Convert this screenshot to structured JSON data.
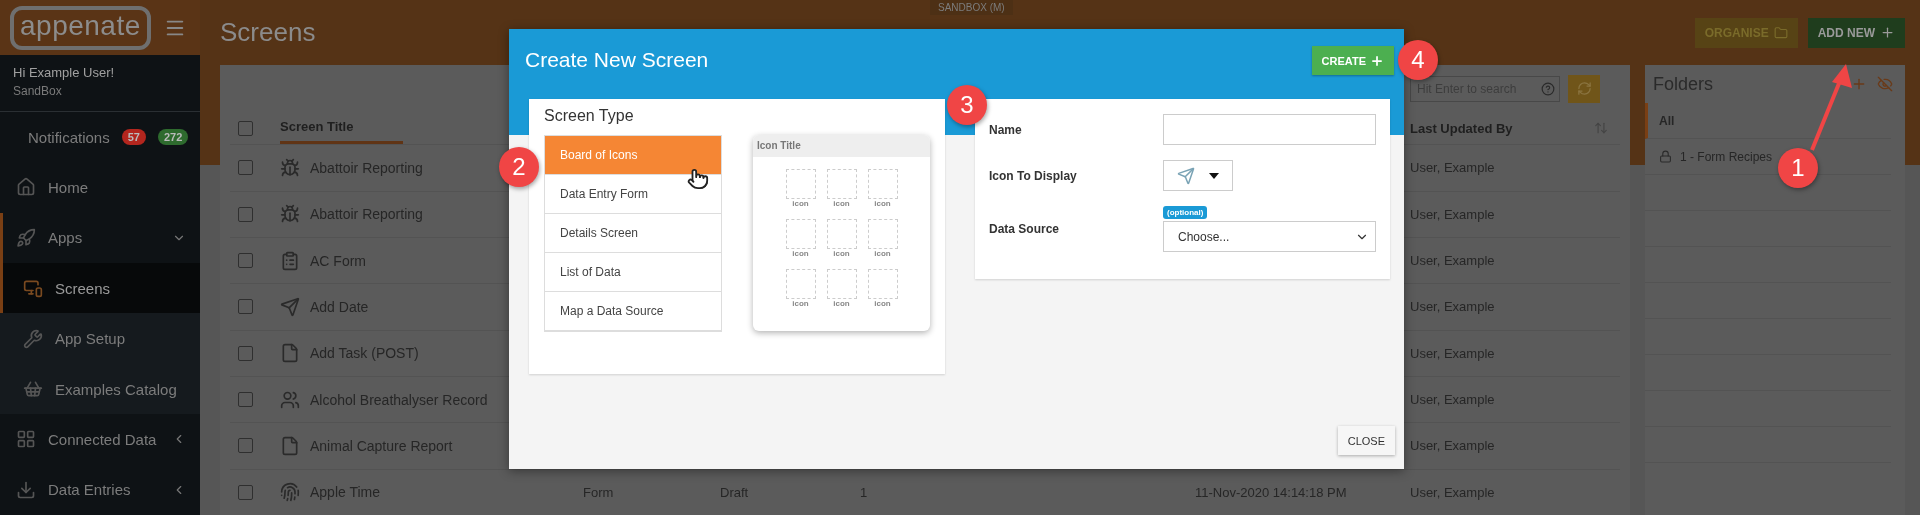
{
  "brand": {
    "name": "appenate"
  },
  "environment_badge": "SANDBOX (M)",
  "user": {
    "greeting": "Hi Example User!",
    "account": "SandBox"
  },
  "sidebar": {
    "items": [
      {
        "label": "Notifications",
        "selected": false,
        "badges": [
          {
            "text": "57",
            "color": "#b3261e"
          },
          {
            "text": "272",
            "color": "#2e6b2e"
          }
        ]
      },
      {
        "label": "Home",
        "selected": false
      },
      {
        "label": "Apps",
        "selected": false,
        "expanded": true,
        "children": [
          {
            "label": "Screens",
            "selected": true
          },
          {
            "label": "App Setup",
            "selected": false
          },
          {
            "label": "Examples Catalog",
            "selected": false
          }
        ]
      },
      {
        "label": "Connected Data",
        "selected": false,
        "expanded": false
      },
      {
        "label": "Data Entries",
        "selected": false,
        "expanded": false
      }
    ]
  },
  "page": {
    "title": "Screens",
    "buttons": [
      {
        "kind": "organise",
        "label": "ORGANISE"
      },
      {
        "kind": "add",
        "label": "ADD NEW"
      }
    ]
  },
  "table": {
    "search": {
      "placeholder": "Hit Enter to search"
    },
    "select_all": {
      "checked": false
    },
    "columns": [
      {
        "label": "Screen Title"
      },
      {
        "label": "Last Updated By"
      }
    ],
    "rows": [
      {
        "title": "Abattoir Reporting",
        "checked": false,
        "updated_by": "User, Example"
      },
      {
        "title": "Abattoir Reporting",
        "checked": false,
        "updated_by": "User, Example"
      },
      {
        "title": "AC Form",
        "checked": false,
        "updated_by": "User, Example"
      },
      {
        "title": "Add Date",
        "checked": false,
        "updated_by": "User, Example"
      },
      {
        "title": "Add Task (POST)",
        "checked": false,
        "updated_by": "User, Example"
      },
      {
        "title": "Alcohol Breathalyser Record",
        "checked": false,
        "updated_by": "User, Example"
      },
      {
        "title": "Animal Capture Report",
        "checked": false,
        "updated_by": "User, Example"
      },
      {
        "title": "Apple Time",
        "checked": false,
        "type": "Form",
        "status": "Draft",
        "version": "1",
        "updated": "11-Nov-2020 14:14:18 PM",
        "updated_by": "User, Example"
      }
    ]
  },
  "folders": {
    "title": "Folders",
    "items": [
      {
        "label": "All",
        "selected": true,
        "locked": false
      },
      {
        "label": "1 - Form Recipes",
        "selected": false,
        "locked": true
      }
    ]
  },
  "dialog": {
    "title": "Create New Screen",
    "create_button": "CREATE",
    "close_button": "CLOSE",
    "screen_type": {
      "title": "Screen Type",
      "options": [
        {
          "label": "Board of Icons",
          "selected": true
        },
        {
          "label": "Data Entry Form",
          "selected": false
        },
        {
          "label": "Details Screen",
          "selected": false
        },
        {
          "label": "List of Data",
          "selected": false
        },
        {
          "label": "Map a Data Source",
          "selected": false
        }
      ],
      "preview": {
        "title": "Icon Title",
        "tiles": [
          "icon",
          "icon",
          "icon",
          "icon",
          "icon",
          "icon",
          "icon",
          "icon",
          "icon"
        ]
      }
    },
    "fields": [
      {
        "kind": "text",
        "label": "Name"
      },
      {
        "kind": "icon",
        "label": "Icon To Display"
      },
      {
        "kind": "select",
        "label": "Data Source",
        "badge": "(optional)",
        "value": "Choose..."
      }
    ]
  },
  "annotations": [
    {
      "number": "1"
    },
    {
      "number": "2"
    },
    {
      "number": "3"
    },
    {
      "number": "4"
    }
  ]
}
